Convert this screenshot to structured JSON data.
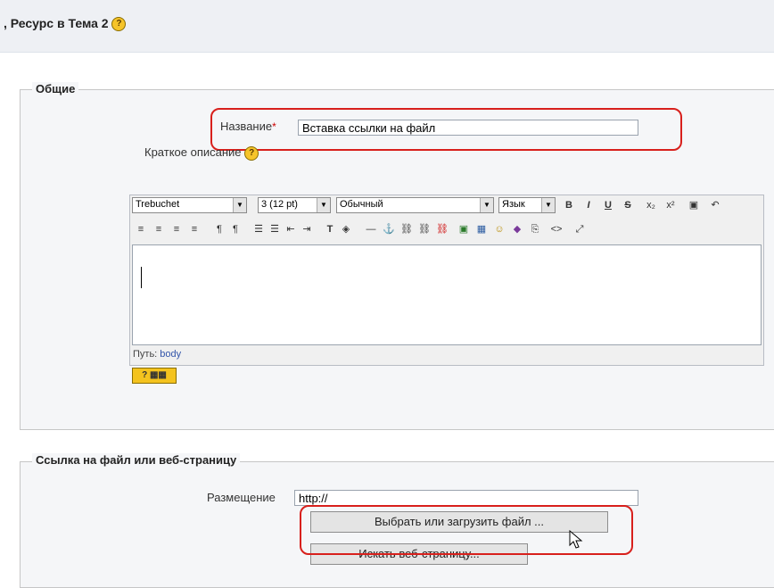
{
  "header": {
    "title": ", Ресурс в Тема 2",
    "help": "?"
  },
  "general": {
    "legend": "Общие",
    "name_label": "Название",
    "required_mark": "*",
    "name_value": "Вставка ссылки на файл",
    "summary_label": "Краткое описание",
    "help": "?"
  },
  "editor": {
    "font": "Trebuchet",
    "size": "3 (12 pt)",
    "format": "Обычный",
    "language": "Язык",
    "path_label": "Путь:",
    "path_value": "body",
    "keyboard_help": "?",
    "toolbar1": [
      "B",
      "I",
      "U",
      "S",
      "x₂",
      "x²",
      "▣",
      "↶"
    ],
    "toolbar2": [
      "≡",
      "≡",
      "≡",
      "≡",
      "¶",
      "¶",
      "☰",
      "☰",
      "⇤",
      "⇥",
      "T",
      "◈",
      "—",
      "⚓",
      "⛓",
      "⛓",
      "⛓",
      "▣",
      "▦",
      "☺",
      "◆",
      "⎘",
      "<>",
      "⤢"
    ]
  },
  "link": {
    "legend": "Ссылка на файл или веб-страницу",
    "location_label": "Размещение",
    "location_value": "http://",
    "choose_button": "Выбрать или загрузить файл ...",
    "search_button": "Искать веб-страницу..."
  }
}
